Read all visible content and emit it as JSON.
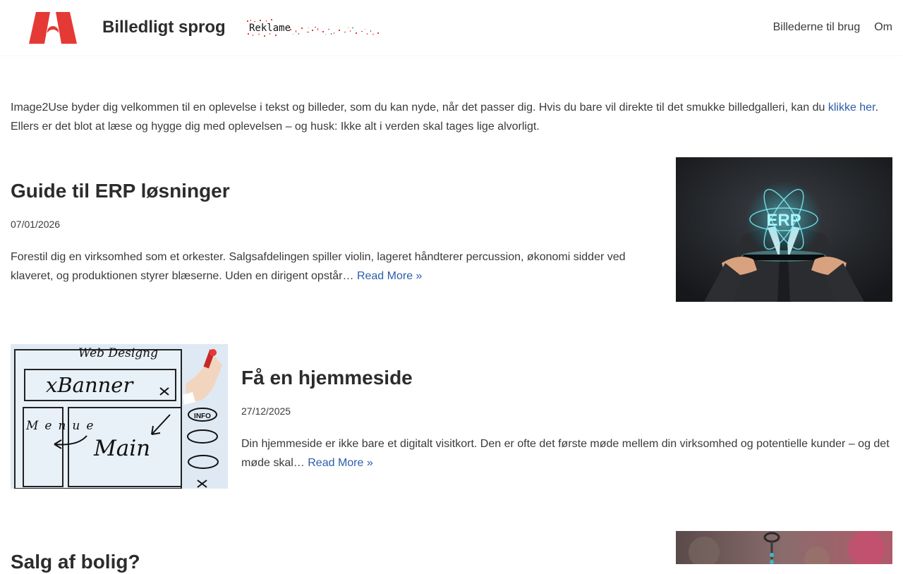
{
  "header": {
    "site_title": "Billedligt sprog",
    "ad_label": "Reklame",
    "nav": [
      "Billederne til brug",
      "Om"
    ]
  },
  "intro": {
    "text_before": "Image2Use byder dig velkommen til en oplevelse i tekst og billeder, som du kan nyde, når det passer dig. Hvis du bare vil direkte til det smukke billedgalleri, kan du ",
    "link": "klikke her",
    "text_after": ". Ellers er det blot at læse og hygge dig med oplevelsen – og husk: Ikke alt i verden skal tages lige alvorligt."
  },
  "posts": [
    {
      "title": "Guide til ERP løsninger",
      "date": "07/01/2026",
      "excerpt": "Forestil dig en virksomhed som et orkester. Salgsafdelingen spiller violin, lageret håndterer percussion, økonomi sidder ved klaveret, og produktionen styrer blæserne. Uden en dirigent opstår… ",
      "read_more": "Read More »",
      "image_text": "ERP"
    },
    {
      "title": "Få en hjemmeside",
      "date": "27/12/2025",
      "excerpt": "Din hjemmeside er ikke bare et digitalt visitkort. Den er ofte det første møde mellem din virksomhed og potentielle kunder – og det møde skal… ",
      "read_more": "Read More »",
      "image_texts": [
        "Web Designg",
        "xBanner",
        "Menue",
        "Main",
        "INFO"
      ]
    },
    {
      "title": "Salg af bolig?"
    }
  ],
  "colors": {
    "link": "#2c5da8",
    "logo": "#e53935",
    "text": "#2c2c2c"
  }
}
